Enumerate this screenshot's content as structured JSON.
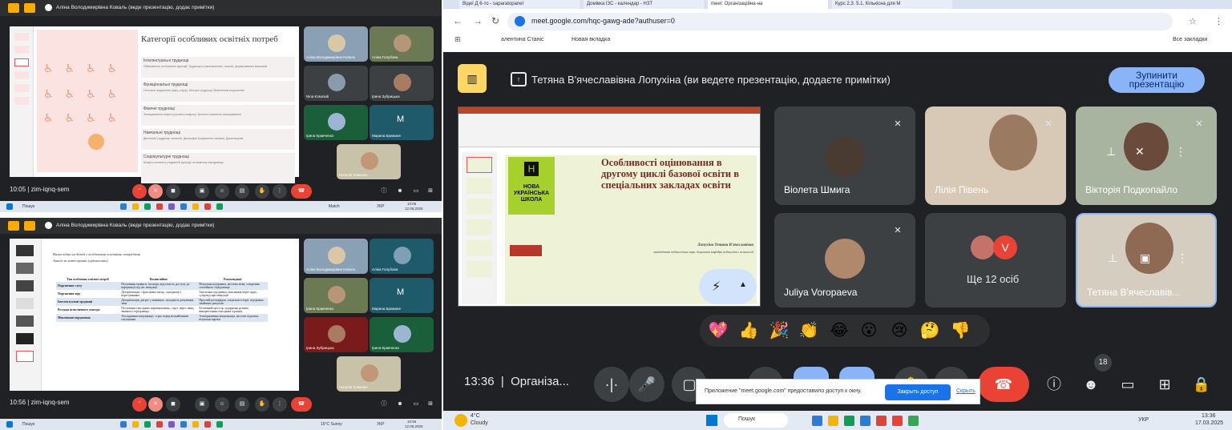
{
  "top_left": {
    "presenter": "Аліна Володимирівна Коваль (веде презентацію, додає примітки)",
    "slide_title": "Категорії особливих освітніх потреб",
    "slide_items": [
      {
        "title": "Інтелектуальні труднощі",
        "text": "Обмеженість когнітивних функцій. Труднощі в узагальненнях, аналізі, формулюванні висновків"
      },
      {
        "title": "Функціональні труднощі",
        "text": "Сенсорні порушення (зору, слуху). Моторні труднощі. Мовленнєві порушення"
      },
      {
        "title": "Фізичні труднощі",
        "text": "Захворювання опорно-рухового апарату. Хронічні соматичні захворювання"
      },
      {
        "title": "Навчальні труднощі",
        "text": "Дислексія (труднощі читання). Дисграфія (порушення письма). Дискалькулія"
      },
      {
        "title": "Соціокультурні труднощі",
        "text": "Можуть полягати у відмінній культурі та мовному середовищі"
      }
    ],
    "tiles": [
      "Аліна Володимирівна Коваль",
      "Аліна Голубова",
      "Nina Krauniuk",
      "Ірина Зубрицька",
      "Ірина Кравченко",
      "Марина Брижане",
      "Наталія Хоменко"
    ],
    "tile_M": "M",
    "time": "10:05",
    "code": "zim-iqnq-sem",
    "task_search": "Пошук",
    "task_weather": "Match",
    "task_lang": "УКР",
    "task_time": "10:05",
    "task_date": "12.06.2025"
  },
  "bottom_left": {
    "presenter": "Аліна Володимирівна Коваль (веде презентацію, додає примітки)",
    "doc_line1": "Вплив війни на дітей з особливими освітніми потребами",
    "doc_line2": "Аналіз за категоріями (орієнтовно)",
    "table_headers": [
      "Тип особливих освітніх потреб",
      "Вплив війни",
      "Рекомендації"
    ],
    "table_rows": [
      [
        "Порушення слуху",
        "Посилення тривоги, ізоляція, відсутність доступу до інформації під час евакуації",
        "Візуальна підтримка, жестова мова, створення спокійного середовища"
      ],
      [
        "Порушення зору",
        "Дезорієнтація, страх нових місць, складнощі з пересуванням",
        "Тактильна підтримка, пояснення через аудіо, супровід при евакуації"
      ],
      [
        "Інтелектуальні труднощі",
        "Дезорієнтація, регрес у навичках, складність розуміння змін",
        "Простий розпорядок, соціальні історії, підтримка знайомих ритуалів"
      ],
      [
        "Розлади аутистичного спектра",
        "Посилення сенсорних перевантажень, стрес через зміну звичного середовища",
        "Безпечний простір, підтримка рутини, використання сенсорних іграшок"
      ],
      [
        "Мовленнєві порушення",
        "Ускладнення комунікації, страх перед незнайомими ситуаціями",
        "Альтернативна комунікація, жестові підказки, візуальні картки"
      ]
    ],
    "tiles": [
      "Аліна Володимирівна Коваль",
      "Аліна Голубова",
      "Ірина Кравченко",
      "Марина Брижане",
      "Ірина Зубрицька",
      "Ірина Кравченко",
      "Наталія Хоменко"
    ],
    "tile_M": "M",
    "time": "10:56",
    "code": "zim-iqnq-sem",
    "task_search": "Пошук",
    "task_weather": "15°C Sunny",
    "task_lang": "УКР",
    "task_time": "10:56",
    "task_date": "12.06.2025"
  },
  "right": {
    "tabs": [
      "Відеї Д 6-то - saparatopanel",
      "Домівка ІЗС - календар - НЗТ",
      "meet: Організаційна-на",
      "Курс 2.3. 5.1. Кількісна для М"
    ],
    "url": "meet.google.com/hqc-gawg-ade?authuser=0",
    "bookmarks": [
      "алентина Станіс",
      "Новая вкладка"
    ],
    "bookmark_all": "Все закладки",
    "presenter_banner": "Тетяна В'ячеславівна Лопухіна (ви ведете презентацію, додаєте примітки)",
    "stop_label": "Зупинити презентацію",
    "slide_title": "Особливості оцінювання в другому циклі базової освіти в спеціальних закладах освіти",
    "slide_logo": "НОВА УКРАЇНСЬКА ШКОЛА",
    "slide_author": "Лопухіна Тетяна В'ячеславівна",
    "slide_author_sub": "кандидатка педагогічних наук, доцентка кафедри педагогіки і психології",
    "participants": [
      "Віолета Шмига",
      "Лілія Півень",
      "Вікторія Подкопайло",
      "Juliya Voropaeva",
      "Ще 12 осіб",
      "Тетяна В'ячеславів..."
    ],
    "more_avatar": "V",
    "emojis": [
      "💖",
      "👍",
      "🎉",
      "👏",
      "😂",
      "😮",
      "😢",
      "🤔",
      "👎"
    ],
    "time": "13:36",
    "meeting_name": "Організа...",
    "people_count": "18",
    "notif_text": "Приложение \"meet.google.com\" предоставило доступ к окну.",
    "notif_btn": "Закрыть доступ",
    "notif_hide": "Скрыть",
    "weather_temp": "4°C",
    "weather_desc": "Cloudy",
    "win_search": "Пошук",
    "lang": "УКР",
    "clock": "13:36",
    "date": "17.03.2025"
  },
  "colors": {
    "meet_bg": "#202124",
    "accent_blue": "#8ab4f8",
    "end_red": "#ea4335",
    "yellow": "#fdd663"
  }
}
